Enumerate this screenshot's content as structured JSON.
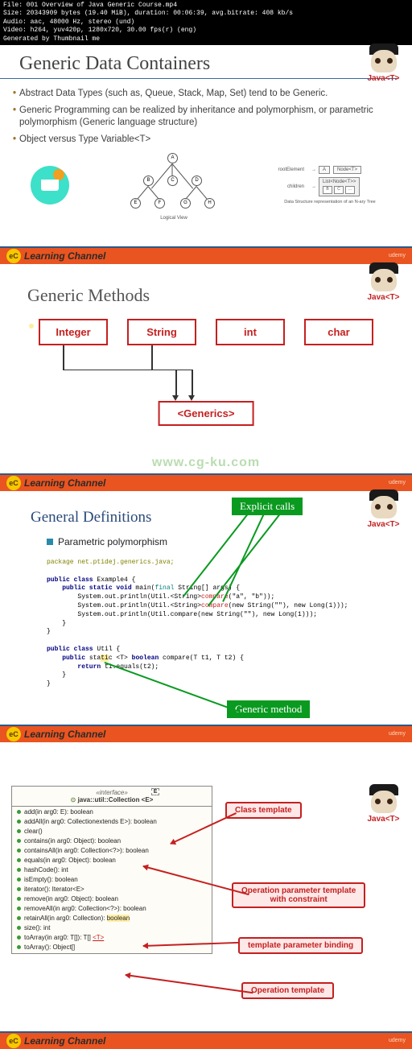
{
  "metadata": {
    "file": "File: 001 Overview of Java Generic Course.mp4",
    "size": "Size: 20343909 bytes (19.40 MiB), duration: 00:06:39, avg.bitrate: 408 kb/s",
    "audio": "Audio: aac, 48000 Hz, stereo (und)",
    "video": "Video: h264, yuv420p, 1280x720, 30.00 fps(r) (eng)",
    "generator": "Generated by Thumbnail me"
  },
  "logo_text": "Java<T>",
  "channel": {
    "badge": "eC",
    "label": "Learning Channel",
    "right": "udemy"
  },
  "slide1": {
    "title": "Generic Data Containers",
    "bullets": [
      "Abstract Data Types (such as, Queue, Stack, Map, Set) tend to be Generic.",
      "Generic Programming can be realized by inheritance and polymorphism, or parametric polymorphism (Generic language structure)",
      "Object versus Type Variable<T>"
    ],
    "tree": {
      "nodes": [
        "A",
        "B",
        "C",
        "D",
        "E",
        "F",
        "G",
        "H"
      ],
      "caption": "Logical View"
    },
    "struct": {
      "root_label": "rootElement",
      "children_label": "children",
      "a_cell": "A",
      "node_label": "Node<T>",
      "list_label": "List<Node<T>>",
      "cells": [
        "B",
        "C",
        "..."
      ],
      "caption": "Data Structure representation of an N-ary Tree"
    }
  },
  "slide2": {
    "title": "Generic Methods",
    "types": [
      "Integer",
      "String",
      "int",
      "char"
    ],
    "generics": "<Generics>",
    "watermark": "www.cg-ku.com"
  },
  "slide3": {
    "title": "General Definitions",
    "label_explicit": "Explicit calls",
    "label_generic": "Generic method",
    "subsection": "Parametric polymorphism",
    "code_lines": {
      "l1": "package net.ptidej.generics.java;",
      "l2": "public class Example4 {",
      "l3": "    public static void main(final String[] args) {",
      "l4a": "        System.out.println(Util.<String>",
      "l4b": "compare",
      "l4c": "(\"a\", \"b\"));",
      "l5a": "        System.out.println(Util.<String>",
      "l5b": "compare",
      "l5c": "(new String(\"\"), new Long(1)));",
      "l6a": "        System.out.println(Util.compare(",
      "l6b": "new String(\"\"), new Long(1)",
      "l6c": "));",
      "l7": "    }",
      "l8": "}",
      "l9": "public class Util {",
      "l10a": "    public sta",
      "l10b": "ti",
      "l10c": "c <T> boolean compare(T t1, T t2) {",
      "l11": "        return t1.equals(t2);",
      "l12": "    }",
      "l13": "}"
    }
  },
  "slide4": {
    "callouts": {
      "class_template": "Class template",
      "op_param_constraint": "Operation parameter template\nwith constraint",
      "template_binding": "template parameter binding",
      "op_template": "Operation template"
    },
    "uml": {
      "interface_tag": "«interface»",
      "class_name": "java::util::Collection <E>",
      "e_box": "E",
      "methods": [
        "add(in arg0: E): boolean",
        "addAll(in arg0: Collection<? extends E>): boolean",
        "clear()",
        "contains(in arg0: Object): boolean",
        "containsAll(in arg0: Collection<?>): boolean",
        "equals(in arg0: Object): boolean",
        "hashCode(): int",
        "isEmpty(): boolean",
        "iterator(): Iterator<E>",
        "remove(in arg0: Object): boolean",
        "removeAll(in arg0: Collection<?>): boolean",
        "retainAll(in arg0: Collection<?>): boolean",
        "size(): int",
        "toArray(in arg0: T[]): T[] <T>",
        "toArray(): Object[]"
      ]
    }
  }
}
